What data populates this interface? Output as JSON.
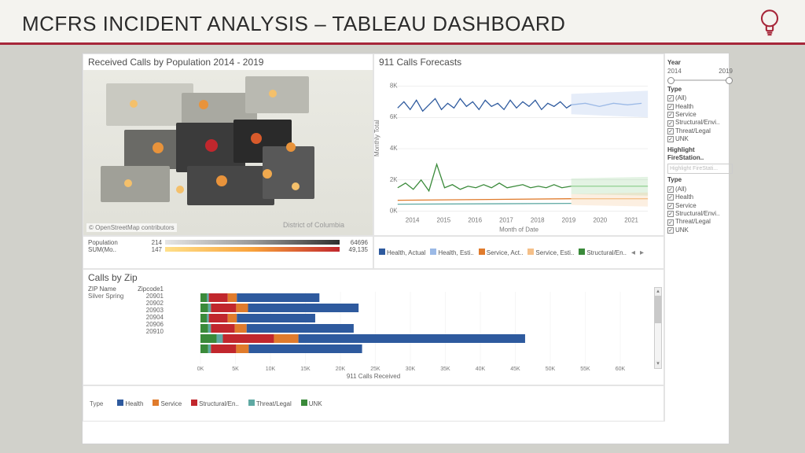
{
  "header": {
    "title": "MCFRS INCIDENT ANALYSIS – TABLEAU DASHBOARD"
  },
  "map_panel": {
    "title": "Received Calls by Population 2014 - 2019",
    "attribution": "© OpenStreetMap contributors",
    "dc_label": "District of Columbia",
    "gradient": {
      "population": {
        "label": "Population",
        "min": "214",
        "max": "64696"
      },
      "sum": {
        "label": "SUM(Mo..",
        "min": "147",
        "max": "49,135"
      }
    }
  },
  "forecast_panel": {
    "title": "911 Calls Forecasts",
    "y_label": "Monthly Total",
    "x_label": "Month of Date",
    "legend": [
      {
        "label": "Health, Actual",
        "color": "#2e5a9e"
      },
      {
        "label": "Health, Esti..",
        "color": "#9bb9e6"
      },
      {
        "label": "Service, Act..",
        "color": "#e07b2c"
      },
      {
        "label": "Service, Esti..",
        "color": "#f5c089"
      },
      {
        "label": "Structural/En..",
        "color": "#3a8a3a"
      }
    ]
  },
  "sidebar": {
    "year": {
      "label": "Year",
      "min": "2014",
      "max": "2019"
    },
    "type_label": "Type",
    "types": [
      "(All)",
      "Health",
      "Service",
      "Structural/Envi..",
      "Threat/Legal",
      "UNK"
    ],
    "highlight": {
      "label": "Highlight FireStation..",
      "placeholder": "Highlight FireStati..."
    }
  },
  "zip_panel": {
    "title": "Calls by Zip",
    "zip_header": "ZIP Name",
    "zipcode_header": "Zipcode1",
    "zipname": "Silver Spring",
    "x_label": "911 Calls Received",
    "legend_label": "Type",
    "legend": [
      {
        "label": "Health",
        "color": "#2e5a9e"
      },
      {
        "label": "Service",
        "color": "#e07b2c"
      },
      {
        "label": "Structural/En..",
        "color": "#c1272d"
      },
      {
        "label": "Threat/Legal",
        "color": "#5fa9a3"
      },
      {
        "label": "UNK",
        "color": "#3a8a3a"
      }
    ]
  },
  "chart_data": [
    {
      "type": "line",
      "title": "911 Calls Forecasts",
      "xlabel": "Month of Date",
      "ylabel": "Monthly Total",
      "ylim": [
        0,
        8000
      ],
      "x_years": [
        2014,
        2015,
        2016,
        2017,
        2018,
        2019,
        2020,
        2021
      ],
      "series": [
        {
          "name": "Health, Actual",
          "color": "#2e5a9e",
          "approx_mean": 6800,
          "range": [
            6200,
            7500
          ],
          "span": "2014-2019"
        },
        {
          "name": "Health, Estimate",
          "color": "#9bb9e6",
          "approx_mean": 6900,
          "band": [
            6200,
            7700
          ],
          "span": "2019-2021"
        },
        {
          "name": "Service, Actual",
          "color": "#e07b2c",
          "approx_mean": 700,
          "range": [
            500,
            900
          ],
          "span": "2014-2019"
        },
        {
          "name": "Service, Estimate",
          "color": "#f5c089",
          "approx_mean": 700,
          "band": [
            400,
            1000
          ],
          "span": "2019-2021"
        },
        {
          "name": "Structural/En, Actual",
          "color": "#3a8a3a",
          "approx_mean": 1600,
          "range": [
            1200,
            2600
          ],
          "span": "2014-2019"
        },
        {
          "name": "Structural/En, Estimate",
          "color": "#8fd08f",
          "approx_mean": 1600,
          "band": [
            1200,
            2000
          ],
          "span": "2019-2021"
        },
        {
          "name": "Threat/Legal, Actual",
          "color": "#5fa9a3",
          "approx_mean": 500,
          "range": [
            300,
            700
          ],
          "span": "2014-2019"
        }
      ]
    },
    {
      "type": "bar",
      "title": "Calls by Zip",
      "orientation": "horizontal",
      "stacked": true,
      "xlabel": "911 Calls Received",
      "xlim": [
        0,
        60000
      ],
      "x_ticks": [
        0,
        5000,
        10000,
        15000,
        20000,
        25000,
        30000,
        35000,
        40000,
        45000,
        50000,
        55000,
        60000
      ],
      "categories": [
        "20901",
        "20902",
        "20903",
        "20904",
        "20906",
        "20910"
      ],
      "series": [
        {
          "name": "Health",
          "color": "#2e5a9e",
          "values": [
            11800,
            15800,
            11200,
            15300,
            32400,
            16200
          ]
        },
        {
          "name": "Service",
          "color": "#e07b2c",
          "values": [
            1300,
            1700,
            1300,
            1700,
            3500,
            1800
          ]
        },
        {
          "name": "Structural/En..",
          "color": "#c1272d",
          "values": [
            2700,
            3600,
            2700,
            3400,
            7300,
            3600
          ]
        },
        {
          "name": "Threat/Legal",
          "color": "#5fa9a3",
          "values": [
            300,
            400,
            300,
            400,
            900,
            400
          ]
        },
        {
          "name": "UNK",
          "color": "#3a8a3a",
          "values": [
            900,
            1100,
            900,
            1100,
            2300,
            1100
          ]
        }
      ]
    },
    {
      "type": "table",
      "title": "Received Calls by Population 2014 - 2019 (map gradient legend)",
      "population_range": [
        214,
        64696
      ],
      "sum_months_range": [
        147,
        49135
      ]
    }
  ]
}
